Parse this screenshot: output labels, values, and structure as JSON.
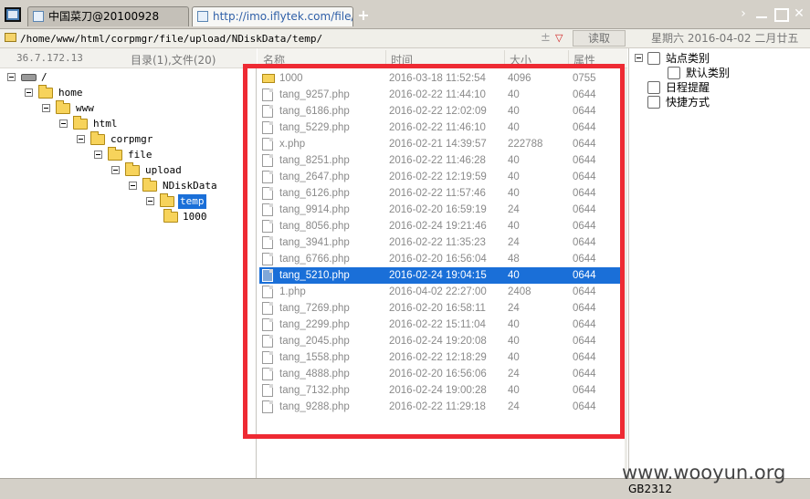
{
  "tabs": [
    {
      "title": "中国菜刀@20100928"
    },
    {
      "title": "http://imo.iflytek.com/file/upl..."
    }
  ],
  "new_tab_label": "+",
  "address": {
    "path": "/home/www/html/corpmgr/file/upload/NDiskData/temp/",
    "read_button": "读取",
    "date": "星期六 2016-04-02 二月廿五"
  },
  "left": {
    "ip": "36.7.172.13",
    "dir_count": "目录(1),文件(20)",
    "tree": [
      {
        "label": "/",
        "depth": 0,
        "type": "drive",
        "selected": false
      },
      {
        "label": "home",
        "depth": 1,
        "type": "folder",
        "selected": false
      },
      {
        "label": "www",
        "depth": 2,
        "type": "folder",
        "selected": false
      },
      {
        "label": "html",
        "depth": 3,
        "type": "folder",
        "selected": false
      },
      {
        "label": "corpmgr",
        "depth": 4,
        "type": "folder",
        "selected": false
      },
      {
        "label": "file",
        "depth": 5,
        "type": "folder",
        "selected": false
      },
      {
        "label": "upload",
        "depth": 6,
        "type": "folder",
        "selected": false
      },
      {
        "label": "NDiskData",
        "depth": 7,
        "type": "folder",
        "selected": false
      },
      {
        "label": "temp",
        "depth": 8,
        "type": "folder",
        "selected": true
      },
      {
        "label": "1000",
        "depth": 9,
        "type": "folder",
        "selected": false
      }
    ]
  },
  "files": {
    "columns": [
      "名称",
      "时间",
      "大小",
      "属性"
    ],
    "rows": [
      {
        "name": "1000",
        "time": "2016-03-18 11:52:54",
        "size": "4096",
        "perm": "0755",
        "type": "folder",
        "selected": false
      },
      {
        "name": "tang_9257.php",
        "time": "2016-02-22 11:44:10",
        "size": "40",
        "perm": "0644",
        "type": "file",
        "selected": false
      },
      {
        "name": "tang_6186.php",
        "time": "2016-02-22 12:02:09",
        "size": "40",
        "perm": "0644",
        "type": "file",
        "selected": false
      },
      {
        "name": "tang_5229.php",
        "time": "2016-02-22 11:46:10",
        "size": "40",
        "perm": "0644",
        "type": "file",
        "selected": false
      },
      {
        "name": "x.php",
        "time": "2016-02-21 14:39:57",
        "size": "222788",
        "perm": "0644",
        "type": "file",
        "selected": false
      },
      {
        "name": "tang_8251.php",
        "time": "2016-02-22 11:46:28",
        "size": "40",
        "perm": "0644",
        "type": "file",
        "selected": false
      },
      {
        "name": "tang_2647.php",
        "time": "2016-02-22 12:19:59",
        "size": "40",
        "perm": "0644",
        "type": "file",
        "selected": false
      },
      {
        "name": "tang_6126.php",
        "time": "2016-02-22 11:57:46",
        "size": "40",
        "perm": "0644",
        "type": "file",
        "selected": false
      },
      {
        "name": "tang_9914.php",
        "time": "2016-02-20 16:59:19",
        "size": "24",
        "perm": "0644",
        "type": "file",
        "selected": false
      },
      {
        "name": "tang_8056.php",
        "time": "2016-02-24 19:21:46",
        "size": "40",
        "perm": "0644",
        "type": "file",
        "selected": false
      },
      {
        "name": "tang_3941.php",
        "time": "2016-02-22 11:35:23",
        "size": "24",
        "perm": "0644",
        "type": "file",
        "selected": false
      },
      {
        "name": "tang_6766.php",
        "time": "2016-02-20 16:56:04",
        "size": "48",
        "perm": "0644",
        "type": "file",
        "selected": false
      },
      {
        "name": "tang_5210.php",
        "time": "2016-02-24 19:04:15",
        "size": "40",
        "perm": "0644",
        "type": "file",
        "selected": true
      },
      {
        "name": "1.php",
        "time": "2016-04-02 22:27:00",
        "size": "2408",
        "perm": "0644",
        "type": "file",
        "selected": false
      },
      {
        "name": "tang_7269.php",
        "time": "2016-02-20 16:58:11",
        "size": "24",
        "perm": "0644",
        "type": "file",
        "selected": false
      },
      {
        "name": "tang_2299.php",
        "time": "2016-02-22 15:11:04",
        "size": "40",
        "perm": "0644",
        "type": "file",
        "selected": false
      },
      {
        "name": "tang_2045.php",
        "time": "2016-02-24 19:20:08",
        "size": "40",
        "perm": "0644",
        "type": "file",
        "selected": false
      },
      {
        "name": "tang_1558.php",
        "time": "2016-02-22 12:18:29",
        "size": "40",
        "perm": "0644",
        "type": "file",
        "selected": false
      },
      {
        "name": "tang_4888.php",
        "time": "2016-02-20 16:56:06",
        "size": "24",
        "perm": "0644",
        "type": "file",
        "selected": false
      },
      {
        "name": "tang_7132.php",
        "time": "2016-02-24 19:00:28",
        "size": "40",
        "perm": "0644",
        "type": "file",
        "selected": false
      },
      {
        "name": "tang_9288.php",
        "time": "2016-02-22 11:29:18",
        "size": "24",
        "perm": "0644",
        "type": "file",
        "selected": false
      }
    ]
  },
  "right": {
    "items": [
      {
        "label": "站点类别",
        "depth": 0,
        "toggle": true
      },
      {
        "label": "默认类别",
        "depth": 1,
        "toggle": false
      },
      {
        "label": "日程提醒",
        "depth": 0,
        "toggle": false
      },
      {
        "label": "快捷方式",
        "depth": 0,
        "toggle": false
      }
    ]
  },
  "status": {
    "encoding": "GB2312"
  },
  "watermark": "www.wooyun.org",
  "colors": {
    "selection": "#1a6fd8",
    "highlight_box": "#ee2a33",
    "chrome": "#d4d0c8"
  }
}
